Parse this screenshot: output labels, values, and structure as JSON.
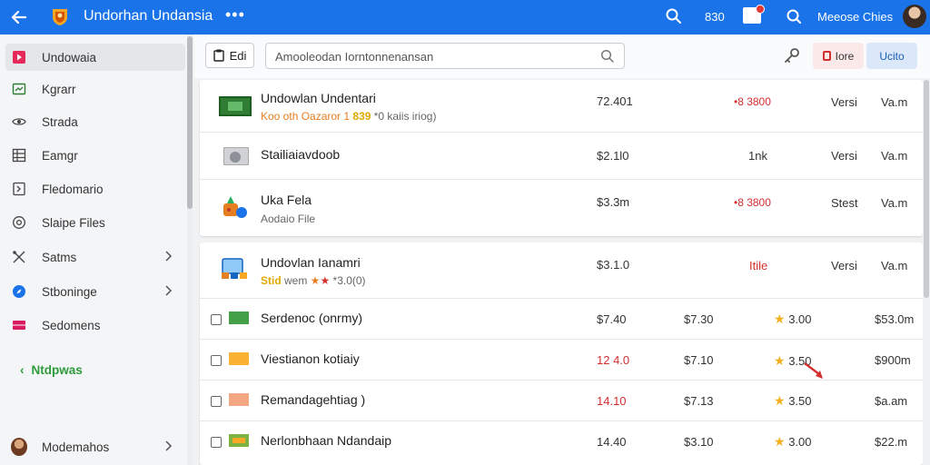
{
  "topbar": {
    "title": "Undorhan Undansia",
    "more": "•••",
    "count": "830",
    "username": "Meeose Chies"
  },
  "sidebar": {
    "items": [
      {
        "label": "Undowaia",
        "icon": "play-icon",
        "active": true
      },
      {
        "label": "Kgrarr",
        "icon": "image-icon"
      },
      {
        "label": "Strada",
        "icon": "eye-icon"
      },
      {
        "label": "Eamgr",
        "icon": "grid-icon"
      },
      {
        "label": "Fledomario",
        "icon": "document-icon"
      },
      {
        "label": "Slaipe Files",
        "icon": "target-icon"
      },
      {
        "label": "Satms",
        "icon": "tools-icon",
        "chevron": true
      },
      {
        "label": "Stboninge",
        "icon": "compass-icon",
        "chevron": true
      },
      {
        "label": "Sedomens",
        "icon": "film-icon"
      }
    ],
    "link": {
      "label": "Ntdpwas",
      "arrow": "‹"
    },
    "footer": {
      "label": "Modemahos"
    }
  },
  "toolbar": {
    "edit_label": "Edi",
    "search_placeholder": "Amooleodan Iorntonnenansan",
    "red_button": "Iore",
    "blue_button": "Ucito"
  },
  "group1": [
    {
      "name": "Undowlan Undentari",
      "sub_prefix": "Koo oth Oazaror 1 ",
      "sub_highlight": "839",
      "sub_suffix": " *0 kaiis iriog)",
      "price": "72.401",
      "badge": "•8 3800",
      "badge_color": "#d32f2f",
      "versi": "Versi",
      "size": "Va.m"
    },
    {
      "name": "Stailiaiavdoob",
      "sub_prefix": "",
      "sub_highlight": "",
      "sub_suffix": "",
      "price": "$2.1l0",
      "badge": "1nk",
      "badge_color": "#333333",
      "versi": "Versi",
      "size": "Va.m"
    },
    {
      "name": "Uka Fela",
      "sub_prefix": "Aodaio File",
      "sub_highlight": "",
      "sub_suffix": "",
      "price": "$3.3m",
      "badge": "•8 3800",
      "badge_color": "#d32f2f",
      "versi": "Stest",
      "size": "Va.m"
    }
  ],
  "group2": {
    "name": "Undovlan Ianamri",
    "sub_prefix": "Stid ",
    "sub_middle": "wem ",
    "sub_suffix": " *3.0(0)",
    "price": "$3.1.0",
    "badge": "Itile",
    "versi": "Versi",
    "size": "Va.m"
  },
  "rows": [
    {
      "name": "Serdenoc (onrmy)",
      "price1": "$7.40",
      "price1_red": false,
      "price2": "$7.30",
      "rating": "3.00",
      "total": "$53.0m"
    },
    {
      "name": "Viestianon kotiaiy",
      "price1": "12 4.0",
      "price1_red": true,
      "price2": "$7.10",
      "rating": "3.50",
      "total": "$900m"
    },
    {
      "name": "Remandagehtiag   )",
      "price1": "14.10",
      "price1_red": true,
      "price2": "$7.13",
      "rating": "3.50",
      "total": "$a.am"
    },
    {
      "name": "Nerlonbhaan Ndandaip",
      "price1": "14.40",
      "price1_red": false,
      "price2": "$3.10",
      "rating": "3.00",
      "total": "$22.m"
    }
  ],
  "star_glyph": "★",
  "colors": {
    "brand": "#1a73e8",
    "accent_red": "#d32f2f",
    "link_green": "#2e9b3a",
    "star": "#f2b01e"
  }
}
